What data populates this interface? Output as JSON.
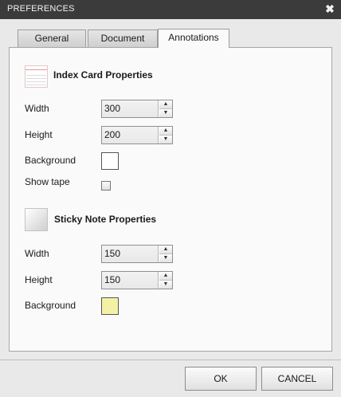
{
  "window": {
    "title": "PREFERENCES",
    "close_glyph": "✖"
  },
  "tabs": [
    {
      "label": "General"
    },
    {
      "label": "Document"
    },
    {
      "label": "Annotations",
      "active": true
    }
  ],
  "index_card": {
    "title": "Index Card Properties",
    "icon": "index-card-icon",
    "width_label": "Width",
    "width_value": "300",
    "height_label": "Height",
    "height_value": "200",
    "background_label": "Background",
    "background_color": "#ffffff",
    "show_tape_label": "Show tape",
    "show_tape_checked": false
  },
  "sticky_note": {
    "title": "Sticky Note Properties",
    "icon": "sticky-note-icon",
    "width_label": "Width",
    "width_value": "150",
    "height_label": "Height",
    "height_value": "150",
    "background_label": "Background",
    "background_color": "#f5f0a8"
  },
  "buttons": {
    "ok": "OK",
    "cancel": "CANCEL"
  },
  "spinner_glyphs": {
    "up": "▲",
    "down": "▼"
  }
}
